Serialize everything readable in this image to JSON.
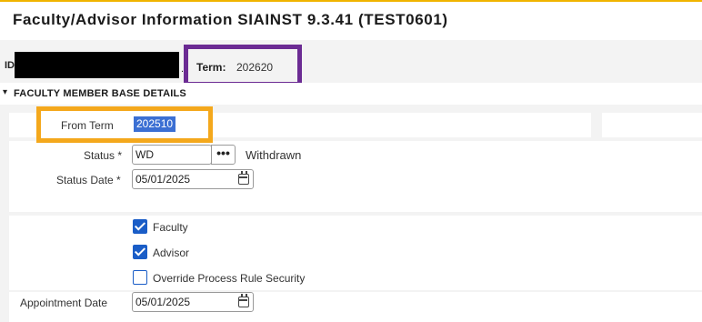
{
  "header": {
    "title": "Faculty/Advisor Information  SIAINST 9.3.41 (TEST0601)"
  },
  "key_block": {
    "id_label": "ID",
    "term_label": "Term:",
    "term_value": "202620"
  },
  "section": {
    "title": "FACULTY MEMBER BASE DETAILS"
  },
  "form": {
    "from_term_label": "From Term",
    "from_term_value": "202510",
    "status_label": "Status *",
    "status_value": "WD",
    "status_lookup_glyph": "•••",
    "status_description": "Withdrawn",
    "status_date_label": "Status Date *",
    "status_date_value": "05/01/2025",
    "faculty_label": "Faculty",
    "faculty_checked": true,
    "advisor_label": "Advisor",
    "advisor_checked": true,
    "override_label": "Override Process Rule Security",
    "override_checked": false,
    "appointment_date_label": "Appointment Date",
    "appointment_date_value": "05/01/2025"
  },
  "icons": {
    "section_toggle": "chevron-down-icon",
    "calendar": "calendar-icon",
    "lookup": "ellipsis-icon"
  },
  "colors": {
    "top_accent": "#f0b400",
    "term_highlight": "#6b2b93",
    "from_term_highlight": "#f4a81c",
    "selection_blue": "#3b6fd3",
    "checkbox_blue": "#1a5dc7"
  }
}
